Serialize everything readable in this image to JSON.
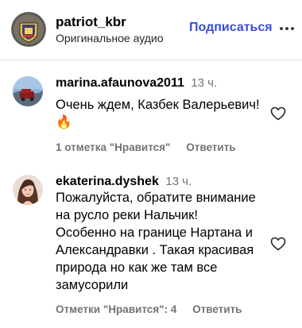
{
  "header": {
    "username": "patriot_kbr",
    "audio_label": "Оригинальное аудио",
    "follow_label": "Подписаться"
  },
  "comments": [
    {
      "username": "marina.afaunova2011",
      "time": "13 ч.",
      "text_lines": [
        "Очень ждем, Казбек Валерьевич!",
        "🔥"
      ],
      "likes_label": "1 отметка \"Нравится\"",
      "reply_label": "Ответить"
    },
    {
      "username": "ekaterina.dyshek",
      "time": "13 ч.",
      "text_lines": [
        "Пожалуйста, обратите внимание",
        "на русло реки Нальчик!",
        "Особенно на границе Нартана и",
        "Александравки . Такая красивая",
        "природа но как же там все",
        "замусорили"
      ],
      "likes_label": "Отметки \"Нравится\": 4",
      "reply_label": "Ответить"
    }
  ],
  "colors": {
    "accent": "#3b4fd6",
    "muted": "#737373",
    "divider": "#dbdbdb"
  },
  "icons": {
    "more": "more-horizontal-icon",
    "like": "heart-outline-icon"
  }
}
